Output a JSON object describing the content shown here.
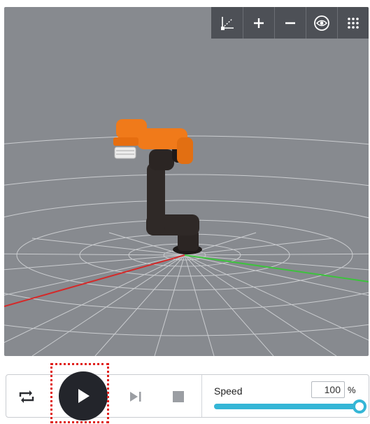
{
  "viewport": {
    "background_color": "#878a8f",
    "toolbar": [
      {
        "icon": "axes-icon"
      },
      {
        "icon": "zoom-in-icon"
      },
      {
        "icon": "zoom-out-icon"
      },
      {
        "icon": "eye-icon"
      },
      {
        "icon": "grid-menu-icon"
      }
    ],
    "robot_colors": {
      "arm_upper": "#f07a1a",
      "arm_lower": "#2b2523",
      "tool": "#e8e8e8"
    },
    "axis_colors": {
      "x": "#d42a2a",
      "y": "#3cc33c"
    }
  },
  "controls": {
    "repeat_icon": "repeat-icon",
    "play_icon": "play-icon",
    "step_icon": "step-forward-icon",
    "stop_icon": "stop-icon",
    "play_highlight_color": "#e0201c",
    "speed": {
      "label": "Speed",
      "value": "100",
      "unit": "%",
      "level_fraction": 1.0,
      "accent_color": "#35b6d6"
    }
  }
}
